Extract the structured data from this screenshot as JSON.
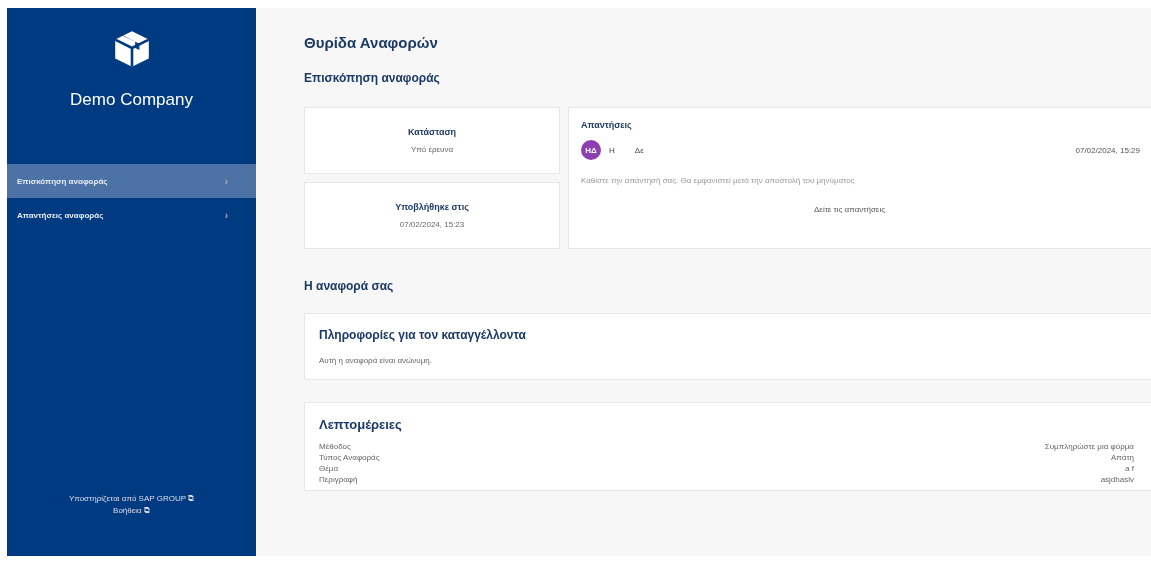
{
  "sidebar": {
    "company": "Demo Company",
    "items": [
      {
        "label": "Επισκόπηση αναφοράς",
        "selected": true,
        "chevron": "›"
      },
      {
        "label": "Απαντήσεις αναφοράς",
        "selected": false,
        "chevron": "›"
      }
    ],
    "footer": [
      {
        "label": "Υποστηρίζεται από SAP GROUP",
        "icon": "⧉"
      },
      {
        "label": "Βοήθεια",
        "icon": "⧉"
      }
    ]
  },
  "page_title": "Θυρίδα Αναφορών",
  "overview": {
    "heading": "Επισκόπηση αναφοράς",
    "status": {
      "label": "Κατάσταση",
      "value": "Υπό έρευνα"
    },
    "submitted": {
      "label": "Υποβλήθηκε στις",
      "value": "07/02/2024, 15:23"
    },
    "replies": {
      "title": "Απαντήσεις",
      "avatar": "ΗΔ",
      "from": "Η",
      "to": "Δε",
      "time": "07/02/2024, 15:29",
      "preview": "Καθίστε την απάντησή σας. Θα εμφανιστεί μετά την αποστολή του μηνύματος",
      "link": "Δείτε τις απαντήσεις"
    }
  },
  "report": {
    "heading": "Η αναφορά σας",
    "reporter": {
      "title": "Πληροφορίες για τον καταγγέλλοντα",
      "text": "Αυτή η αναφορά είναι ανώνυμη."
    },
    "details": {
      "title": "Λεπτομέρειες",
      "rows": [
        {
          "label": "Μέθοδος",
          "value": "Συμπληρώστε μια φόρμα"
        },
        {
          "label": "Τύπος Αναφοράς",
          "value": "Απάτη"
        },
        {
          "label": "Θέμα",
          "value": "a f"
        },
        {
          "label": "Περιγραφή",
          "value": "asjdhaslv"
        }
      ]
    }
  }
}
